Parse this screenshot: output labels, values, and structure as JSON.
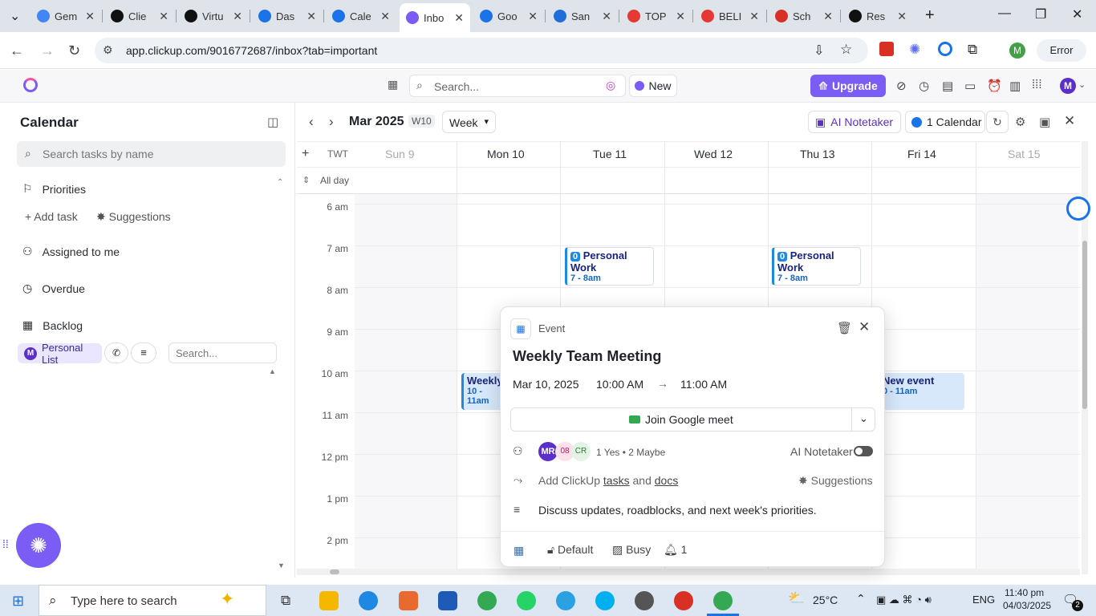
{
  "browser": {
    "tabs": [
      {
        "label": "Gem",
        "color": "#4285f4"
      },
      {
        "label": "Clie",
        "color": "#111"
      },
      {
        "label": "Virtu",
        "color": "#111"
      },
      {
        "label": "Das",
        "color": "#1a73e8"
      },
      {
        "label": "Cale",
        "color": "#1a73e8"
      },
      {
        "label": "Inbo",
        "color": "#7b5cf5"
      },
      {
        "label": "Goo",
        "color": "#1a73e8"
      },
      {
        "label": "San",
        "color": "#1e6fd9"
      },
      {
        "label": "TOP",
        "color": "#e53935"
      },
      {
        "label": "BELI",
        "color": "#e53935"
      },
      {
        "label": "Sch",
        "color": "#d93025"
      },
      {
        "label": "Res",
        "color": "#111"
      }
    ],
    "url": "app.clickup.com/9016772687/inbox?tab=important",
    "error_label": "Error",
    "profile_initial": "M"
  },
  "topbar": {
    "search_placeholder": "Search...",
    "new_label": "New",
    "upgrade_label": "Upgrade",
    "avatar": "M"
  },
  "sidebar": {
    "title": "Calendar",
    "search_placeholder": "Search tasks by name",
    "priorities": "Priorities",
    "add_task": "Add task",
    "suggestions": "Suggestions",
    "items": [
      "Assigned to me",
      "Overdue",
      "Backlog"
    ],
    "list_badge_initial": "M",
    "list_name": "Personal List",
    "list_search_placeholder": "Search..."
  },
  "calendar": {
    "month": "Mar 2025",
    "week": "W10",
    "view": "Week",
    "ai_notetaker": "AI Notetaker",
    "calendars": "1 Calendar",
    "timezone": "TWT",
    "all_day": "All day",
    "days": [
      "Sun 9",
      "Mon 10",
      "Tue 11",
      "Wed 12",
      "Thu 13",
      "Fri 14",
      "Sat 15"
    ],
    "hours": [
      "6 am",
      "7 am",
      "8 am",
      "9 am",
      "10 am",
      "11 am",
      "12 pm",
      "1 pm",
      "2 pm"
    ],
    "events": [
      {
        "title": "Personal Work",
        "time": "7 - 8am",
        "badge": "0"
      },
      {
        "title": "Personal Work",
        "time": "7 - 8am",
        "badge": "0"
      },
      {
        "title": "Weekly",
        "time": "10 - 11am"
      },
      {
        "title": "New event",
        "time": "0 - 11am"
      }
    ]
  },
  "popover": {
    "type": "Event",
    "title": "Weekly Team Meeting",
    "date": "Mar 10, 2025",
    "start": "10:00 AM",
    "arrow": "→",
    "end": "11:00 AM",
    "join": "Join Google meet",
    "attendees": [
      "MR",
      "08",
      "CR"
    ],
    "rsvp": "1 Yes • 2 Maybe",
    "ai_notetaker": "AI Notetaker",
    "add_prefix": "Add ClickUp",
    "tasks_link": "tasks",
    "and": "and",
    "docs_link": "docs",
    "suggestions": "Suggestions",
    "description": "Discuss updates, roadblocks, and next week's priorities.",
    "calendar_default": "Default",
    "busy": "Busy",
    "reminders": "1"
  },
  "taskbar": {
    "search_placeholder": "Type here to search",
    "temperature": "25°C",
    "lang": "ENG",
    "time": "11:40 pm",
    "date": "04/03/2025",
    "notifications": "2"
  }
}
